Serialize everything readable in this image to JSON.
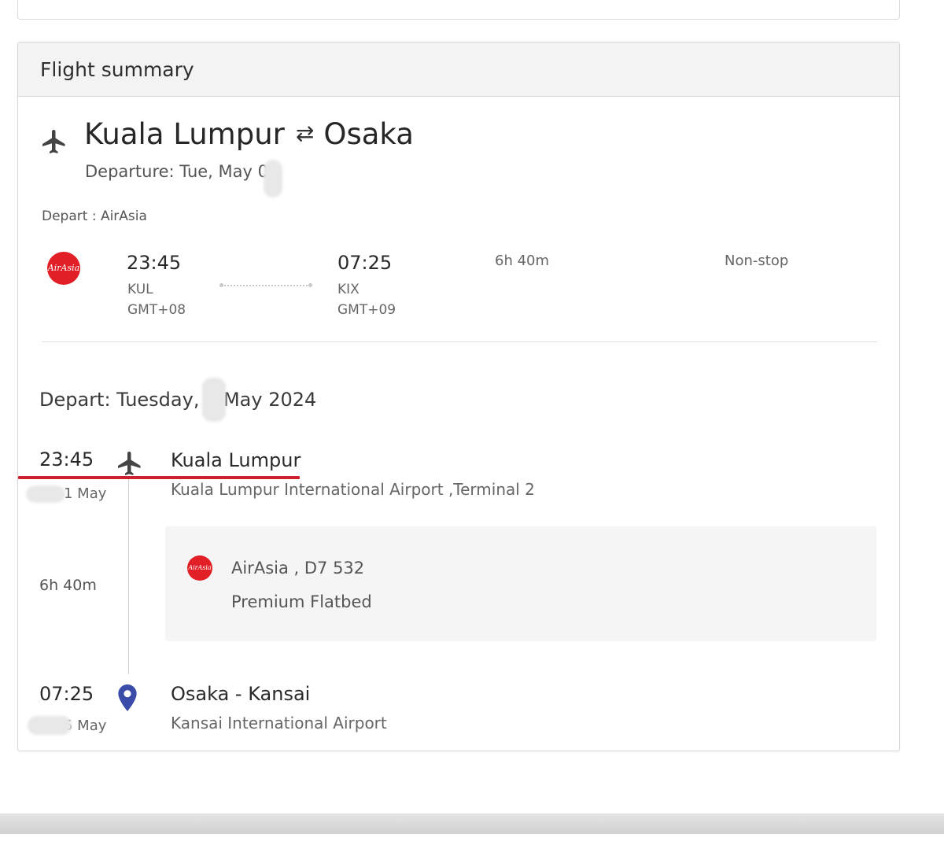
{
  "header": {
    "title": "Flight summary"
  },
  "route": {
    "origin": "Kuala Lumpur",
    "swap_icon": "⇄",
    "destination": "Osaka",
    "departure_text": "Departure: Tue, May 0"
  },
  "overview": {
    "depart_airline": "Depart : AirAsia",
    "airline_logo_text": "AirAsia",
    "origin_time": "23:45",
    "origin_code": "KUL",
    "origin_tz": "GMT+08",
    "destination_time": "07:25",
    "destination_code": "KIX",
    "destination_tz": "GMT+09",
    "duration": "6h 40m",
    "stops": "Non-stop"
  },
  "itinerary": {
    "depart_date": "Depart: Tuesday, 1 May 2024",
    "departure": {
      "time": "23:45",
      "date": "1 May",
      "place": "Kuala Lumpur",
      "airport": "Kuala Lumpur International Airport ,Terminal 2"
    },
    "flight": {
      "duration": "6h 40m",
      "airline_logo_text": "AirAsia",
      "airline_flight": "AirAsia , D7 532",
      "cabin": "Premium Flatbed"
    },
    "arrival": {
      "time": "07:25",
      "date": "5 May",
      "place": "Osaka - Kansai",
      "airport": "Kansai International Airport"
    }
  },
  "colors": {
    "brand_red": "#e21f26",
    "highlight_red": "#d0202e",
    "pin_blue": "#3b4ba8"
  }
}
